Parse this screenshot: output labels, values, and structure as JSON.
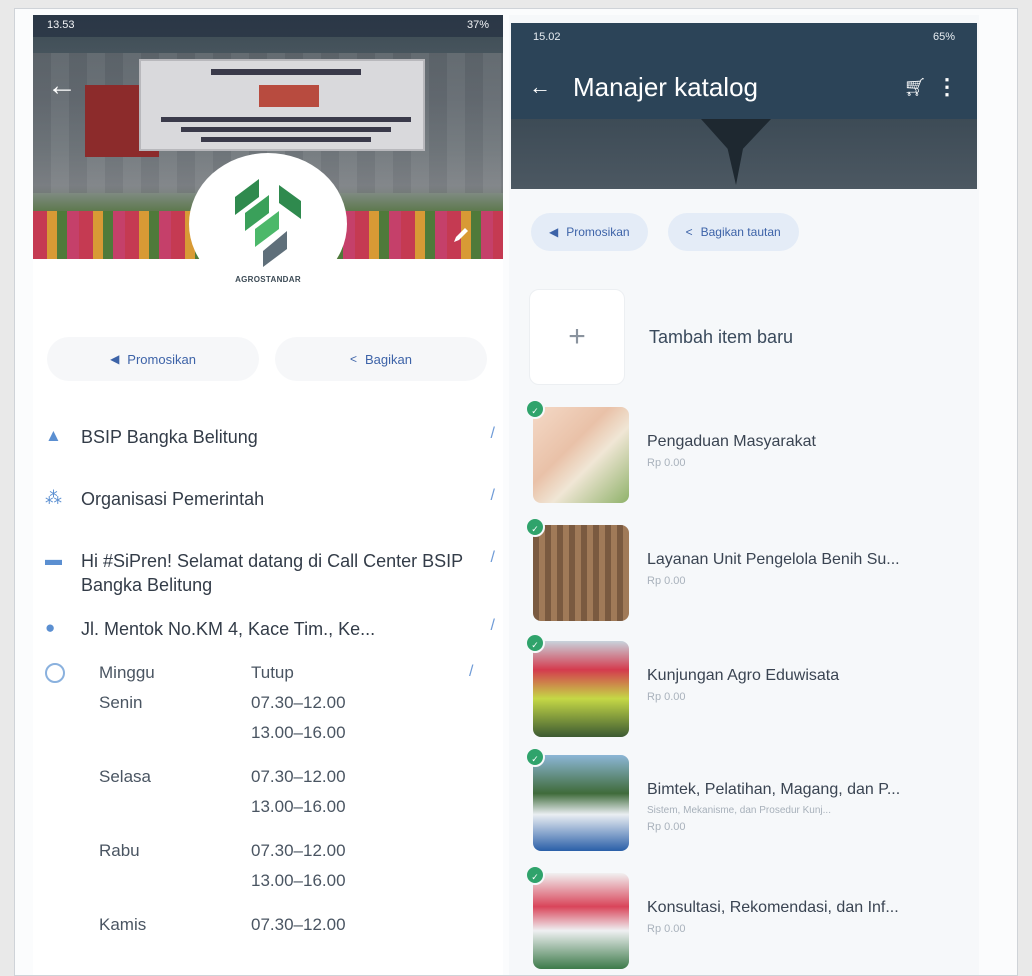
{
  "left": {
    "status": {
      "time": "13.53",
      "right": "37%"
    },
    "logo_text": "AGROSTANDAR",
    "buttons": {
      "promote": "Promosikan",
      "share": "Bagikan"
    },
    "profile": {
      "name": "BSIP Bangka Belitung",
      "category": "Organisasi Pemerintah",
      "description": "Hi #SiPren! Selamat datang di Call Center BSIP Bangka Belitung",
      "address": "Jl. Mentok No.KM 4, Kace Tim., Ke..."
    },
    "hours": [
      {
        "day": "Minggu",
        "time": "Tutup"
      },
      {
        "day": "Senin",
        "time": "07.30–12.00"
      },
      {
        "day": "",
        "time": "13.00–16.00"
      },
      {
        "day": "Selasa",
        "time": "07.30–12.00"
      },
      {
        "day": "",
        "time": "13.00–16.00"
      },
      {
        "day": "Rabu",
        "time": "07.30–12.00"
      },
      {
        "day": "",
        "time": "13.00–16.00"
      },
      {
        "day": "Kamis",
        "time": "07.30–12.00"
      }
    ]
  },
  "right": {
    "status": {
      "time": "15.02",
      "right": "65%"
    },
    "title": "Manajer katalog",
    "buttons": {
      "promote": "Promosikan",
      "share_link": "Bagikan tautan"
    },
    "add_item": "Tambah item baru",
    "items": [
      {
        "name": "Pengaduan Masyarakat",
        "sub": "",
        "price": "Rp 0.00"
      },
      {
        "name": "Layanan Unit Pengelola Benih Su...",
        "sub": "",
        "price": "Rp 0.00"
      },
      {
        "name": "Kunjungan Agro Eduwisata",
        "sub": "",
        "price": "Rp 0.00"
      },
      {
        "name": "Bimtek, Pelatihan, Magang, dan P...",
        "sub": "Sistem, Mekanisme, dan Prosedur Kunj...",
        "price": "Rp 0.00"
      },
      {
        "name": "Konsultasi, Rekomendasi, dan Inf...",
        "sub": "",
        "price": "Rp 0.00"
      }
    ]
  },
  "colors": {
    "accent": "#3d63a8",
    "appbar": "#2c4458",
    "badge": "#2fa36b"
  }
}
